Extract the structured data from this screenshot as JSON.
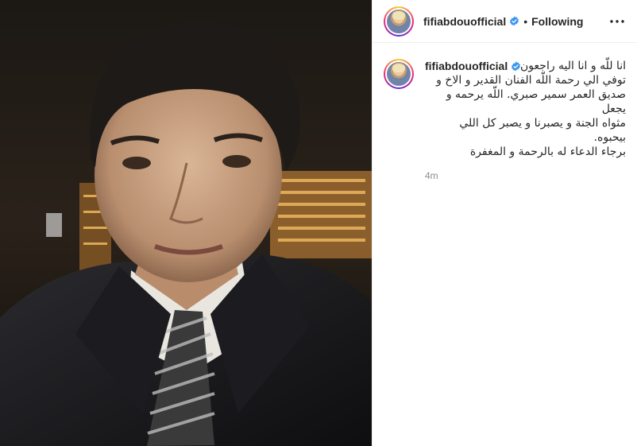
{
  "post": {
    "username": "fifiabdouofficial",
    "verified": true,
    "separator": "•",
    "follow_status": "Following",
    "caption": "انا للّه و انا اليه راجعون\nتوفي الي رحمة اللّه الفنان القدير و الاخ و\nصديق العمر سمير صبري. اللّه يرحمه و يجعل\nمثواه الجنة و يصبرنا و يصبر كل اللي بيحبوه.\nبرجاء الدعاء له بالرحمة و المغفرة",
    "time_ago": "4m"
  },
  "icons": {
    "verified": "verified-badge-icon",
    "more": "more-options-icon"
  },
  "colors": {
    "verified_blue": "#3897f0",
    "text": "#262626",
    "muted": "#8e8e8e"
  }
}
